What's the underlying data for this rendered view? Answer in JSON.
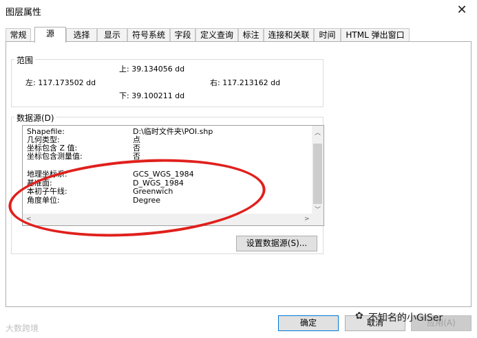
{
  "window": {
    "title": "图层属性",
    "close_symbol": "✕"
  },
  "tabs": [
    {
      "label": "常规"
    },
    {
      "label": "源"
    },
    {
      "label": "选择"
    },
    {
      "label": "显示"
    },
    {
      "label": "符号系统"
    },
    {
      "label": "字段"
    },
    {
      "label": "定义查询"
    },
    {
      "label": "标注"
    },
    {
      "label": "连接和关联"
    },
    {
      "label": "时间"
    },
    {
      "label": "HTML 弹出窗口"
    }
  ],
  "active_tab": "源",
  "extent": {
    "label": "范围",
    "top": "上: 39.134056 dd",
    "left": "左: 117.173502 dd",
    "right": "右: 117.213162 dd",
    "bottom": "下: 39.100211 dd"
  },
  "datasource": {
    "label": "数据源(D)",
    "rows": [
      {
        "key": "Shapefile:",
        "value": "D:\\临时文件夹\\POI.shp"
      },
      {
        "key": "几何类型:",
        "value": "点"
      },
      {
        "key": "坐标包含 Z 值:",
        "value": "否"
      },
      {
        "key": "坐标包含测量值:",
        "value": "否"
      },
      {
        "key": "地理坐标系:",
        "value": "GCS_WGS_1984"
      },
      {
        "key": "基准面:",
        "value": "D_WGS_1984"
      },
      {
        "key": "本初子午线:",
        "value": "Greenwich"
      },
      {
        "key": "角度单位:",
        "value": "Degree"
      }
    ],
    "set_button": "设置数据源(S)..."
  },
  "buttons": {
    "ok": "确定",
    "cancel": "取消",
    "apply": "应用(A)"
  },
  "watermarks": {
    "left": "大数跨境",
    "right": "不知名的小GISer"
  },
  "colors": {
    "highlight_ellipse": "#e0201c",
    "focus_border": "#0078d7"
  }
}
